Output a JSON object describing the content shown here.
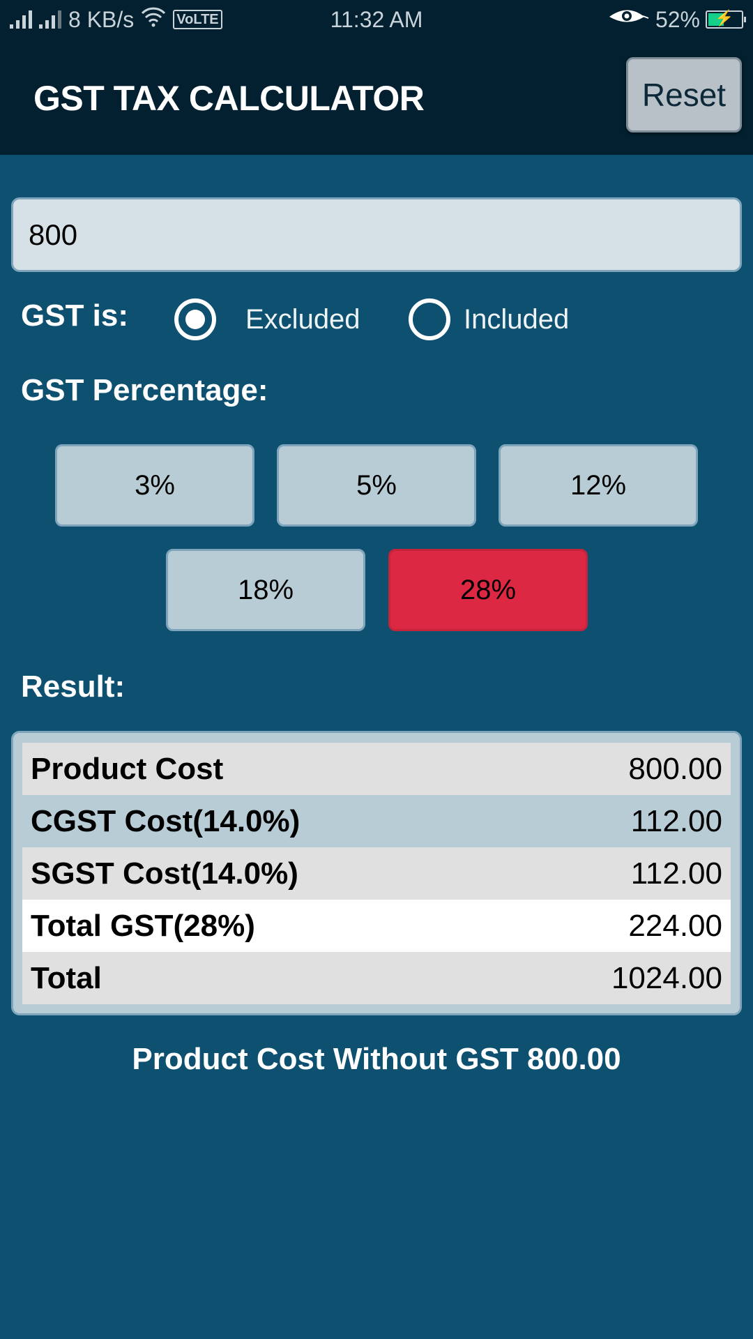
{
  "status_bar": {
    "network_speed": "8 KB/s",
    "volte": "VoLTE",
    "time": "11:32 AM",
    "battery": "52%",
    "battery_level": 0.52,
    "icons": [
      "signal-icon",
      "signal-icon",
      "wifi-icon",
      "volte-icon",
      "eye-comfort-icon",
      "battery-charging-icon"
    ]
  },
  "app_bar": {
    "title": "GST TAX CALCULATOR",
    "reset_label": "Reset"
  },
  "amount_input": {
    "value": "800"
  },
  "gst_mode": {
    "label": "GST is:",
    "options": [
      {
        "label": "Excluded",
        "selected": true
      },
      {
        "label": "Included",
        "selected": false
      }
    ]
  },
  "gst_percentage": {
    "label": "GST Percentage:",
    "options": [
      "3%",
      "5%",
      "12%",
      "18%",
      "28%"
    ],
    "selected": "28%",
    "active_color": "#dc2842"
  },
  "result": {
    "label": "Result:",
    "rows": [
      {
        "label": "Product Cost",
        "value": "800.00"
      },
      {
        "label": "CGST Cost(14.0%)",
        "value": "112.00"
      },
      {
        "label": "SGST Cost(14.0%)",
        "value": "112.00"
      },
      {
        "label": "Total GST(28%)",
        "value": "224.00"
      },
      {
        "label": "Total",
        "value": "1024.00"
      }
    ]
  },
  "footer_note": "Product Cost Without GST 800.00"
}
